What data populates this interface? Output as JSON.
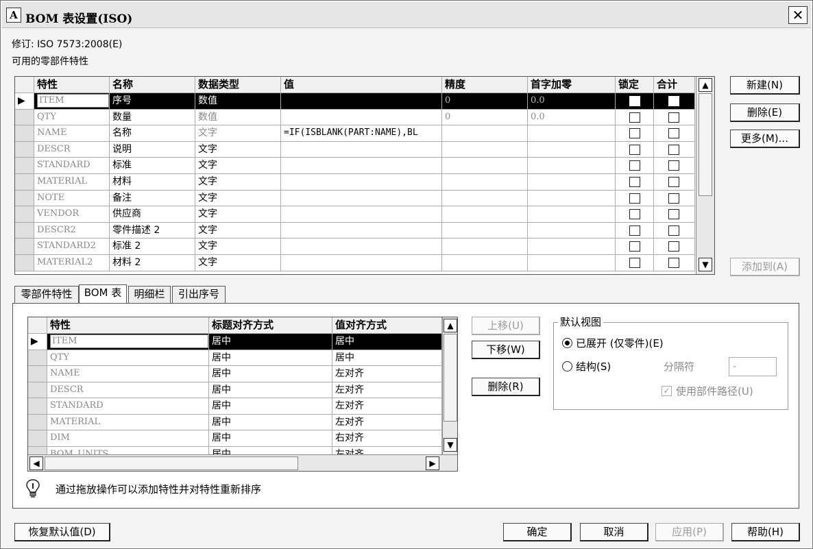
{
  "window": {
    "title": "BOM 表设置(ISO)",
    "icon": "autocad-icon"
  },
  "revision_label": "修订: ISO 7573:2008(E)",
  "available_props_label": "可用的零部件特性",
  "props_table": {
    "columns": [
      "特性",
      "名称",
      "数据类型",
      "值",
      "精度",
      "首字加零",
      "锁定",
      "合计"
    ],
    "rows": [
      {
        "prop": "ITEM",
        "name": "序号",
        "type": "数值",
        "value": "",
        "precision": "0",
        "zero": "0.0"
      },
      {
        "prop": "QTY",
        "name": "数量",
        "type": "数值",
        "value": "",
        "precision": "0",
        "zero": "0.0"
      },
      {
        "prop": "NAME",
        "name": "名称",
        "type": "文字",
        "value": "=IF(ISBLANK(PART:NAME),BL",
        "precision": "",
        "zero": ""
      },
      {
        "prop": "DESCR",
        "name": "说明",
        "type": "文字",
        "value": "",
        "precision": "",
        "zero": ""
      },
      {
        "prop": "STANDARD",
        "name": "标准",
        "type": "文字",
        "value": "",
        "precision": "",
        "zero": ""
      },
      {
        "prop": "MATERIAL",
        "name": "材料",
        "type": "文字",
        "value": "",
        "precision": "",
        "zero": ""
      },
      {
        "prop": "NOTE",
        "name": "备注",
        "type": "文字",
        "value": "",
        "precision": "",
        "zero": ""
      },
      {
        "prop": "VENDOR",
        "name": "供应商",
        "type": "文字",
        "value": "",
        "precision": "",
        "zero": ""
      },
      {
        "prop": "DESCR2",
        "name": "零件描述 2",
        "type": "文字",
        "value": "",
        "precision": "",
        "zero": ""
      },
      {
        "prop": "STANDARD2",
        "name": "标准 2",
        "type": "文字",
        "value": "",
        "precision": "",
        "zero": ""
      },
      {
        "prop": "MATERIAL2",
        "name": "材料 2",
        "type": "文字",
        "value": "",
        "precision": "",
        "zero": ""
      }
    ]
  },
  "right_buttons": {
    "new": "新建(N)",
    "delete": "删除(E)",
    "more": "更多(M)...",
    "add_to": "添加到(A)"
  },
  "tabs": [
    "零部件特性",
    "BOM 表",
    "明细栏",
    "引出序号"
  ],
  "bom_table": {
    "columns": [
      "特性",
      "标题对齐方式",
      "值对齐方式"
    ],
    "rows": [
      {
        "prop": "ITEM",
        "title_align": "居中",
        "value_align": "居中"
      },
      {
        "prop": "QTY",
        "title_align": "居中",
        "value_align": "居中"
      },
      {
        "prop": "NAME",
        "title_align": "居中",
        "value_align": "左对齐"
      },
      {
        "prop": "DESCR",
        "title_align": "居中",
        "value_align": "左对齐"
      },
      {
        "prop": "STANDARD",
        "title_align": "居中",
        "value_align": "左对齐"
      },
      {
        "prop": "MATERIAL",
        "title_align": "居中",
        "value_align": "左对齐"
      },
      {
        "prop": "DIM",
        "title_align": "居中",
        "value_align": "右对齐"
      },
      {
        "prop": "BOM_UNITS",
        "title_align": "居中",
        "value_align": "左对齐"
      }
    ]
  },
  "move_buttons": {
    "up": "上移(U)",
    "down": "下移(W)",
    "delete": "删除(R)"
  },
  "default_view": {
    "label": "默认视图",
    "expanded": "已展开 (仅零件)(E)",
    "structured": "结构(S)",
    "separator_label": "分隔符",
    "separator_value": "-",
    "use_path": "使用部件路径(U)"
  },
  "hint": "通过拖放操作可以添加特性并对特性重新排序",
  "footer": {
    "restore": "恢复默认值(D)",
    "ok": "确定",
    "cancel": "取消",
    "apply": "应用(P)",
    "help": "帮助(H)"
  }
}
